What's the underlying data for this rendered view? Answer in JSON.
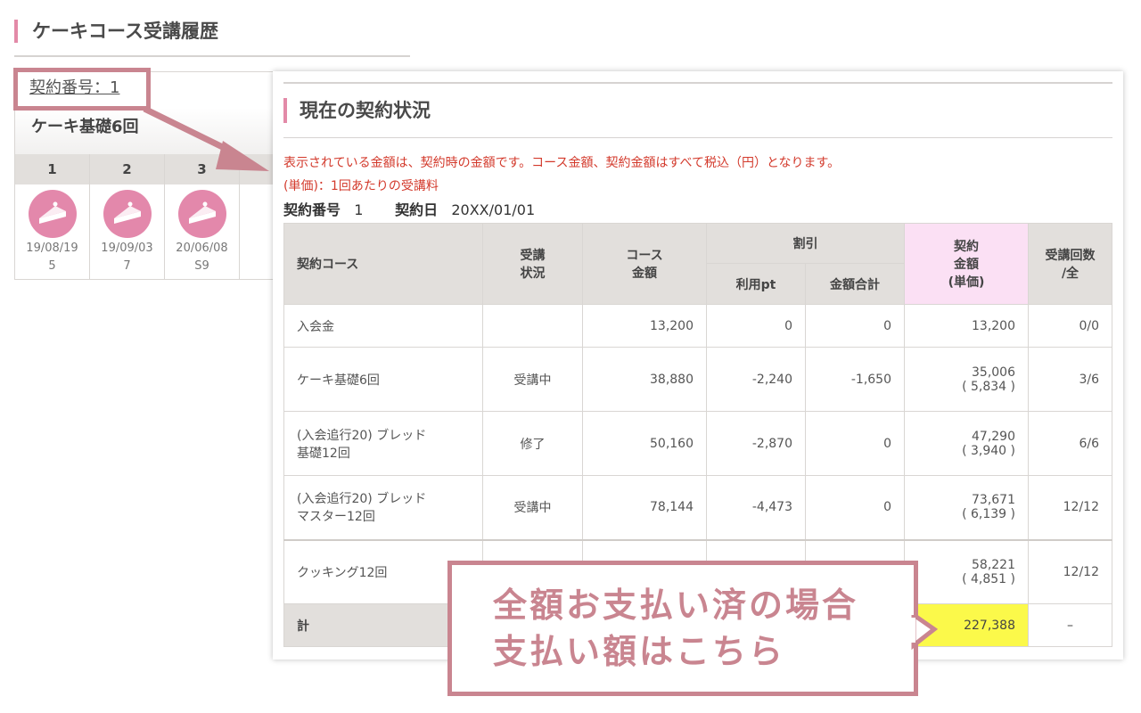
{
  "page": {
    "title": "ケーキコース受講履歴"
  },
  "left_card": {
    "contract_link": "契約番号：1",
    "course_name": "ケーキ基礎6回",
    "sessions": [
      {
        "num": "1",
        "date": "19/08/19",
        "sub": "5"
      },
      {
        "num": "2",
        "date": "19/09/03",
        "sub": "7"
      },
      {
        "num": "3",
        "date": "20/06/08",
        "sub": "S9"
      }
    ]
  },
  "panel": {
    "heading": "現在の契約状況",
    "note1": "表示されている金額は、契約時の金額です。コース金額、契約金額はすべて税込（円）となります。",
    "note2": "(単価)：1回あたりの受講料",
    "meta": {
      "contract_no_label": "契約番号",
      "contract_no": "1",
      "date_label": "契約日",
      "date": "20XX/01/01"
    },
    "table": {
      "headers": {
        "course": "契約コース",
        "status_1": "受講",
        "status_2": "状況",
        "price_1": "コース",
        "price_2": "金額",
        "discount": "割引",
        "points": "利用pt",
        "discount_total": "金額合計",
        "contract_1": "契約",
        "contract_2": "金額",
        "contract_3": "(単価)",
        "count_1": "受講回数",
        "count_2": "/全"
      },
      "rows": [
        {
          "course_1": "入会金",
          "course_2": "",
          "status": "",
          "price": "13,200",
          "points": "0",
          "discount_total": "0",
          "contract": "13,200",
          "unit": "",
          "count": "0/0"
        },
        {
          "course_1": "ケーキ基礎6回",
          "course_2": "",
          "status": "受講中",
          "price": "38,880",
          "points": "-2,240",
          "discount_total": "-1,650",
          "contract": "35,006",
          "unit": "( 5,834 )",
          "count": "3/6"
        },
        {
          "course_1": "(入会追行20) ブレッド",
          "course_2": "基礎12回",
          "status": "修了",
          "price": "50,160",
          "points": "-2,870",
          "discount_total": "0",
          "contract": "47,290",
          "unit": "( 3,940 )",
          "count": "6/6"
        },
        {
          "course_1": "(入会追行20) ブレッド",
          "course_2": "マスター12回",
          "status": "受講中",
          "price": "78,144",
          "points": "-4,473",
          "discount_total": "0",
          "contract": "73,671",
          "unit": "( 6,139 )",
          "count": "12/12"
        },
        {
          "course_1": "クッキング12回",
          "course_2": "",
          "status": "",
          "price": "",
          "points": "",
          "discount_total": "",
          "contract": "58,221",
          "unit": "( 4,851 )",
          "count": "12/12"
        }
      ],
      "total": {
        "label": "計",
        "contract": "227,388",
        "count": "–"
      }
    }
  },
  "callout": {
    "line1": "全額お支払い済の場合",
    "line2": "支払い額はこちら"
  },
  "colors": {
    "accent_pink": "#e38aa8",
    "annotation": "#c98590",
    "note_red": "#d33a2c",
    "highlight_yellow": "#fbf94a",
    "header_pink": "#fbe0f4"
  }
}
